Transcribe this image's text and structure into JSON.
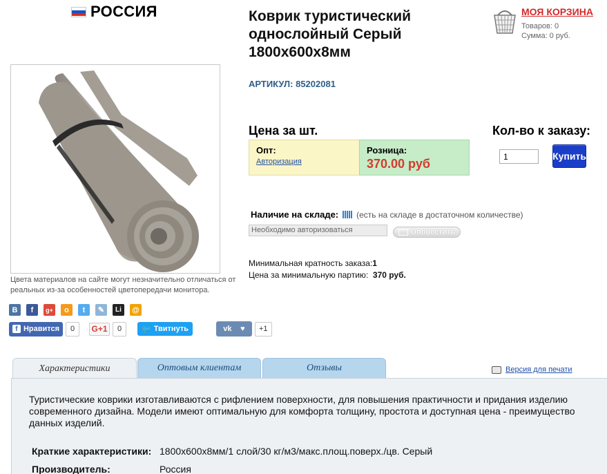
{
  "country": {
    "name": "РОССИЯ",
    "flag_colors": [
      "#ffffff",
      "#1e4fc4",
      "#d52b1e"
    ]
  },
  "product": {
    "title": "Коврик туристический однослойный Серый 1800х600х8мм",
    "sku": "АРТИКУЛ: 85202081",
    "image_note": "Цвета материалов на сайте могут незначительно отличаться от реальных из-за особенностей цветопередачи монитора."
  },
  "cart": {
    "title": "МОЯ КОРЗИНА",
    "items": "Товаров: 0",
    "sum": "Сумма: 0 руб."
  },
  "pricing": {
    "heading": "Цена за шт.",
    "qty_heading": "Кол-во к заказу:",
    "wholesale_label": "Опт:",
    "wholesale_link": "Авторизация",
    "retail_label": "Розница:",
    "retail_value": "370.00 руб",
    "qty_value": "1",
    "buy_label": "Купить"
  },
  "stock": {
    "label": "Наличие на складе:",
    "status": "(есть на складе в достаточном количестве)",
    "notify_placeholder": "Необходимо авторизоваться",
    "notify_button": "Оповестить"
  },
  "min_order": {
    "multiplicity_label": "Минимальная кратность заказа:",
    "multiplicity_value": "1",
    "batch_label": "Цена за минимальную партию:",
    "batch_value": "370 руб."
  },
  "share": {
    "icons": [
      {
        "name": "vk-share-icon",
        "glyph": "В",
        "color": "#4c75a3"
      },
      {
        "name": "facebook-share-icon",
        "glyph": "f",
        "color": "#3b5998"
      },
      {
        "name": "googleplus-share-icon",
        "glyph": "g+",
        "color": "#dd4b39"
      },
      {
        "name": "odnoklassniki-share-icon",
        "glyph": "о",
        "color": "#f59a1a"
      },
      {
        "name": "twitter-share-icon",
        "glyph": "t",
        "color": "#55acee"
      },
      {
        "name": "livejournal-share-icon",
        "glyph": "✎",
        "color": "#8fb6d8"
      },
      {
        "name": "liveinternet-share-icon",
        "glyph": "Li",
        "color": "#222222"
      },
      {
        "name": "mailru-share-icon",
        "glyph": "@",
        "color": "#f0a400"
      }
    ],
    "fb_like": "Нравится",
    "fb_count": "0",
    "gplus_label": "G+1",
    "gplus_count": "0",
    "tweet_label": "Твитнуть",
    "vk_label": "vk",
    "vk_count": "+1"
  },
  "tabs": [
    {
      "label": "Характеристики",
      "active": true
    },
    {
      "label": "Оптовым клиентам",
      "active": false
    },
    {
      "label": "Отзывы",
      "active": false
    }
  ],
  "print_link": "Версия для печати",
  "description": "Туристические коврики изготавливаются с рифлением поверхности, для повышения практичности и придания изделию современного дизайна. Модели имеют оптимальную для комфорта толщину, простота и доступная цена - преимущество данных изделий.",
  "specs": [
    {
      "label": "Краткие характеристики:",
      "value": "1800х600х8мм/1 слой/30 кг/м3/макс.площ.поверх./цв. Серый"
    },
    {
      "label": "Производитель:",
      "value": "Россия"
    }
  ]
}
